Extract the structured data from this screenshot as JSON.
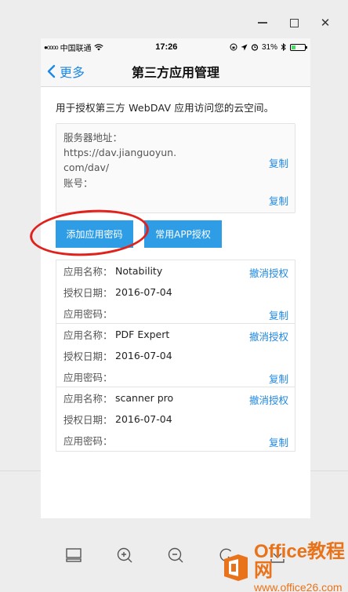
{
  "window": {
    "controls": {
      "minimize": "—",
      "maximize": "□",
      "close": "✕"
    }
  },
  "status_bar": {
    "carrier": "中国联通",
    "signal": "●oooo",
    "time": "17:26",
    "battery_percent": "31%",
    "battery_level": 0.31,
    "icons": [
      "signal-icon",
      "wifi-icon",
      "lock-rotation-icon",
      "location-icon",
      "alarm-icon",
      "bluetooth-icon",
      "battery-icon"
    ]
  },
  "nav": {
    "back_label": "更多",
    "title": "第三方应用管理"
  },
  "intro_text": "用于授权第三方 WebDAV 应用访问您的云空间。",
  "server": {
    "address_label": "服务器地址：",
    "address_value": "https://dav.jianguoyun.com/dav/",
    "copy_label": "复制",
    "account_label": "账号：",
    "account_copy_label": "复制"
  },
  "buttons": {
    "add_password": "添加应用密码",
    "common_auth": "常用APP授权"
  },
  "apps": [
    {
      "name_key": "应用名称：",
      "name": "Notability",
      "date_key": "授权日期：",
      "date": "2016-07-04",
      "pwd_key": "应用密码：",
      "revoke": "撤消授权",
      "copy": "复制"
    },
    {
      "name_key": "应用名称：",
      "name": "PDF Expert",
      "date_key": "授权日期：",
      "date": "2016-07-04",
      "pwd_key": "应用密码：",
      "revoke": "撤消授权",
      "copy": "复制"
    },
    {
      "name_key": "应用名称：",
      "name": "scanner pro",
      "date_key": "授权日期：",
      "date": "2016-07-04",
      "pwd_key": "应用密码：",
      "revoke": "撤消授权",
      "copy": "复制"
    }
  ],
  "toolbar": {
    "icons": [
      "layout-icon",
      "zoom-in-icon",
      "zoom-out-icon",
      "rotate-icon",
      "download-icon"
    ]
  },
  "watermark": {
    "title": "Office教程网",
    "subtitle": "www.office26.com"
  },
  "colors": {
    "accent": "#1e88e5",
    "button": "#2e9de6",
    "annotation": "#e0211c",
    "watermark": "#e8731a"
  }
}
